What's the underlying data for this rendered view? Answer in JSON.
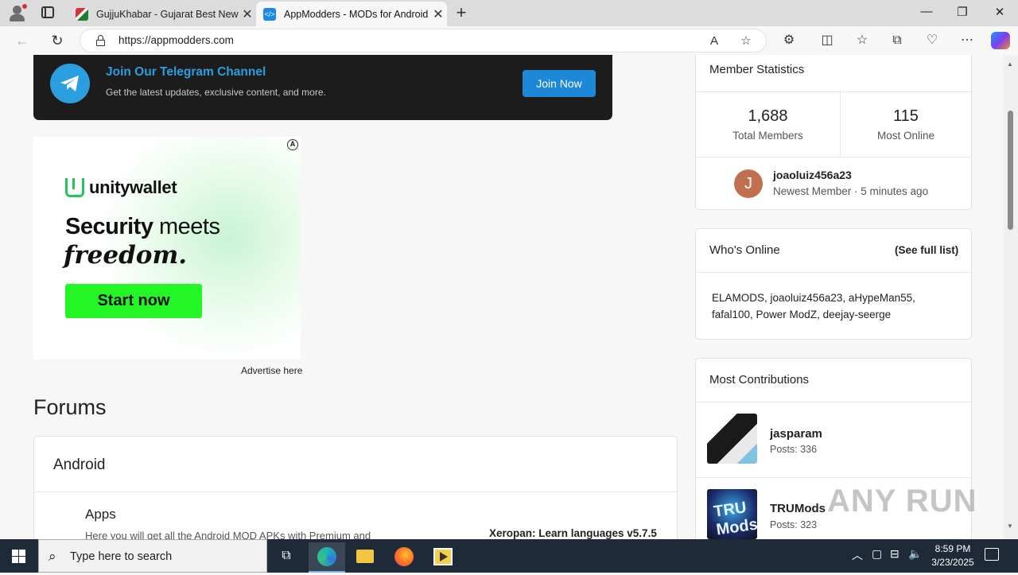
{
  "browser": {
    "tabs": [
      {
        "title": "GujjuKhabar - Gujarat Best News"
      },
      {
        "title": "AppModders - MODs for Android"
      }
    ],
    "url": "https://appmodders.com",
    "new_tab_symbol": "+",
    "close_symbol": "✕"
  },
  "telegram": {
    "title": "Join Our Telegram Channel",
    "subtitle": "Get the latest updates, exclusive content, and more.",
    "button": "Join Now"
  },
  "ad": {
    "brand": "unitywallet",
    "headline_bold": "Security",
    "headline_rest": " meets",
    "headline2": "freedom.",
    "cta": "Start now",
    "advertise": "Advertise here"
  },
  "forums": {
    "heading": "Forums",
    "category": "Android",
    "subforum": "Apps",
    "description": "Here you will get all the Android MOD APKs with Premium and",
    "latest": "Xeropan: Learn languages v5.7.5"
  },
  "member_stats": {
    "title": "Member Statistics",
    "total_members": "1,688",
    "total_members_label": "Total Members",
    "most_online": "115",
    "most_online_label": "Most Online",
    "newest_initial": "J",
    "newest_name": "joaoluiz456a23",
    "newest_meta": "Newest Member · 5 minutes ago"
  },
  "whos_online": {
    "title": "Who's Online",
    "link": "(See full list)",
    "users": "ELAMODS, joaoluiz456a23, aHypeMan55, fafal100, Power ModZ, deejay-seerge"
  },
  "contributions": {
    "title": "Most Contributions",
    "items": [
      {
        "name": "jasparam",
        "posts": "Posts: 336"
      },
      {
        "name": "TRUMods",
        "posts": "Posts: 323",
        "avatar_text": "TRU Mods"
      }
    ]
  },
  "watermark": "ANY RUN",
  "taskbar": {
    "search_placeholder": "Type here to search",
    "time": "8:59 PM",
    "date": "3/23/2025"
  },
  "colors": {
    "telegram_blue": "#2b9ee0",
    "join_button": "#1e88d8",
    "cta_green": "#24f524",
    "taskbar": "#1f2a38"
  }
}
